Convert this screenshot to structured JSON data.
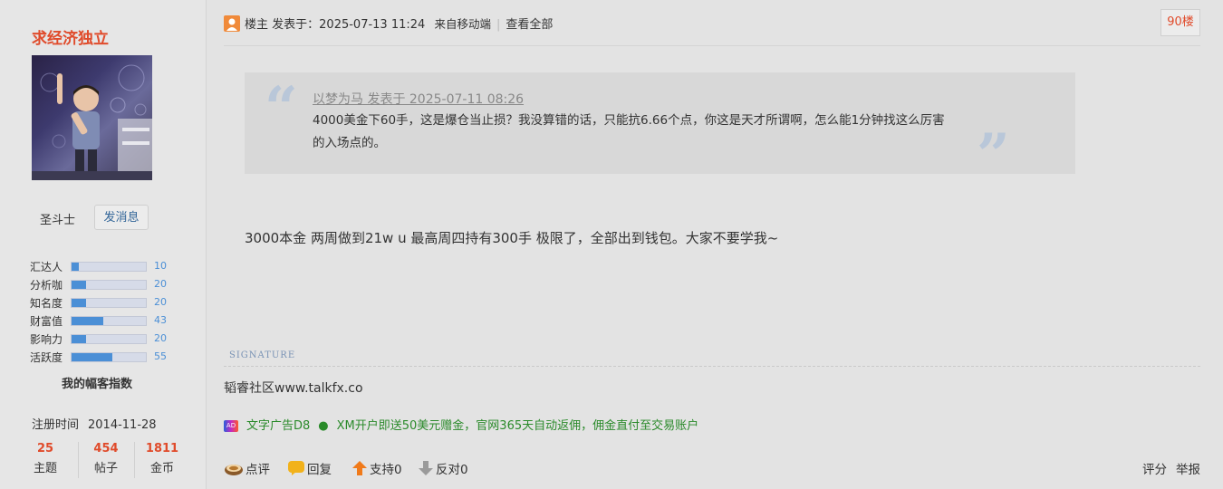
{
  "profile": {
    "username": "求经济独立",
    "rank": "圣斗士",
    "message_button": "发消息",
    "stats": [
      {
        "label": "汇达人",
        "value": "10",
        "fraction": 0.1
      },
      {
        "label": "分析咖",
        "value": "20",
        "fraction": 0.2
      },
      {
        "label": "知名度",
        "value": "20",
        "fraction": 0.2
      },
      {
        "label": "财富值",
        "value": "43",
        "fraction": 0.43
      },
      {
        "label": "影响力",
        "value": "20",
        "fraction": 0.2
      },
      {
        "label": "活跃度",
        "value": "55",
        "fraction": 0.55
      }
    ],
    "index_label": "我的幅客指数",
    "reg_label": "注册时间",
    "reg_date": "2014-11-28",
    "counts": [
      {
        "num": "25",
        "label": "主题"
      },
      {
        "num": "454",
        "label": "帖子"
      },
      {
        "num": "1811",
        "label": "金币"
      }
    ]
  },
  "post": {
    "op_label": "楼主",
    "posted_at": "发表于：2025-07-13 11:24",
    "source": "来自移动端",
    "view_all": "查看全部",
    "floor": "90楼",
    "quote": {
      "meta": "以梦为马 发表于 2025-07-11 08:26",
      "text": "4000美金下60手，这是爆仓当止损？我没算错的话，只能抗6.66个点，你这是天才所谓啊，怎么能1分钟找这么厉害的入场点的。"
    },
    "body": "3000本金 两周做到21w u 最高周四持有300手 极限了，全部出到钱包。大家不要学我~",
    "signature_label": "SIGNATURE",
    "signature": "韬睿社区www.talkfx.co",
    "ad_label": "文字广告D8",
    "ad_dot": "●",
    "ad_text": "XM开户即送50美元赠金，官网365天自动返佣，佣金直付至交易账户"
  },
  "actions": {
    "comment": "点评",
    "reply": "回复",
    "support": "支持0",
    "oppose": "反对0",
    "rate": "评分",
    "report": "举报"
  },
  "colors": {
    "accent_red": "#e04b2b",
    "link_blue": "#336699",
    "bar_blue": "#4b8fd6",
    "ad_green": "#2a8a2a"
  }
}
